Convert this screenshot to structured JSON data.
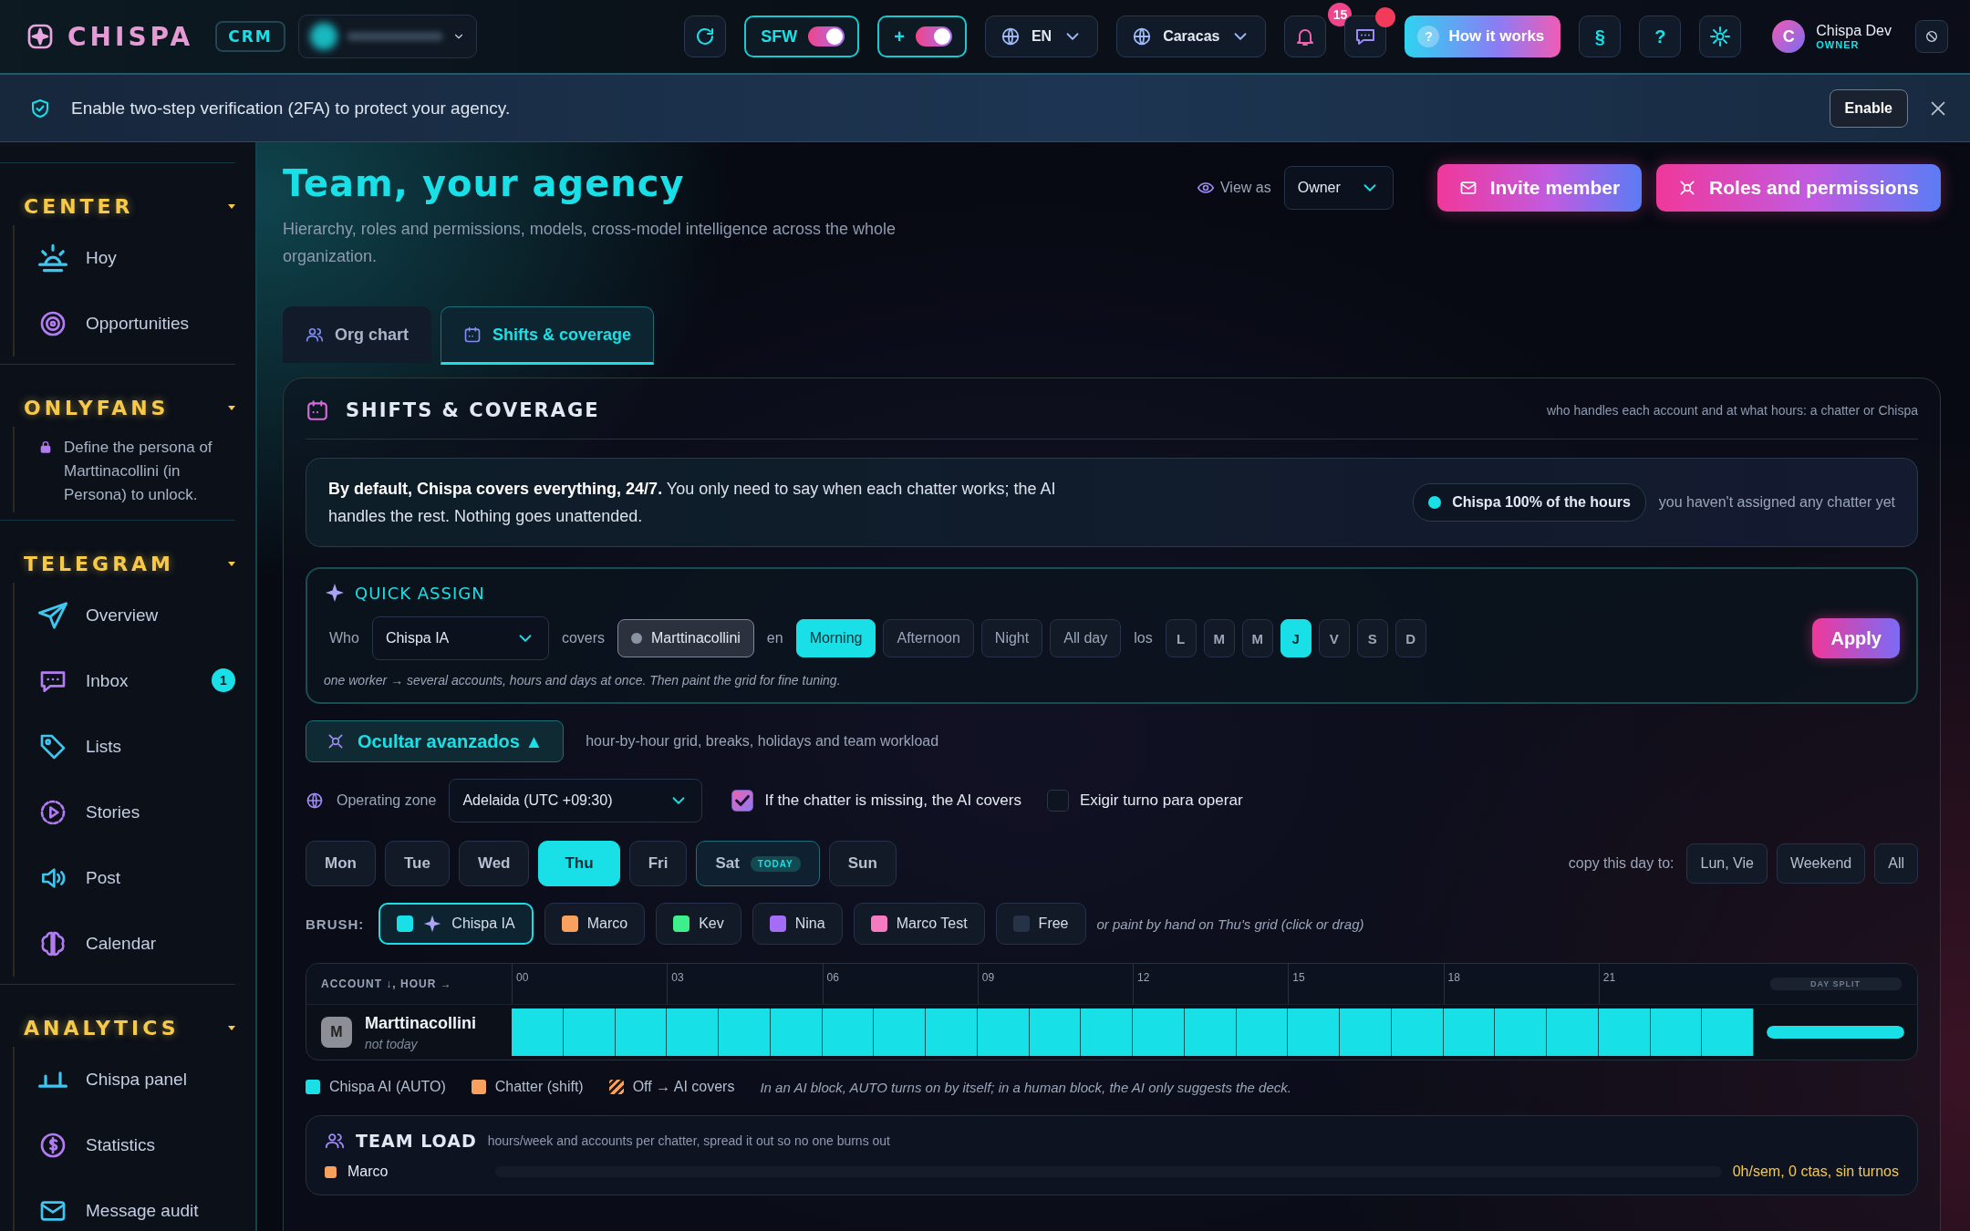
{
  "topbar": {
    "logo": "CHISPA",
    "badge": "CRM",
    "sfw": {
      "label": "SFW",
      "on": true
    },
    "plus_toggle": {
      "label": "+",
      "on": true
    },
    "language": "EN",
    "timezone": "Caracas",
    "notifications": {
      "count": "15"
    },
    "messages": {
      "unread": true
    },
    "help_button": {
      "icon": "?",
      "label": "How it works"
    },
    "section_button": "§",
    "question_button": "?",
    "user": {
      "initial": "C",
      "name": "Chispa Dev",
      "role": "OWNER"
    }
  },
  "banner": {
    "text": "Enable two-step verification (2FA) to protect your agency.",
    "button": "Enable"
  },
  "sidebar": {
    "sections": [
      {
        "title": "CENTER",
        "expanded": true,
        "items": [
          {
            "label": "Hoy"
          },
          {
            "label": "Opportunities"
          }
        ]
      },
      {
        "title": "ONLYFANS",
        "expanded": true,
        "note": "Define the persona of Marttinacollini (in Persona) to unlock."
      },
      {
        "title": "TELEGRAM",
        "expanded": true,
        "items": [
          {
            "label": "Overview"
          },
          {
            "label": "Inbox",
            "badge": "1"
          },
          {
            "label": "Lists"
          },
          {
            "label": "Stories"
          },
          {
            "label": "Post"
          },
          {
            "label": "Calendar"
          }
        ]
      },
      {
        "title": "ANALYTICS",
        "expanded": true,
        "items": [
          {
            "label": "Chispa panel"
          },
          {
            "label": "Statistics"
          },
          {
            "label": "Message audit"
          }
        ]
      }
    ]
  },
  "header": {
    "title": "Team, your agency",
    "subtitle": "Hierarchy, roles and permissions, models, cross-model intelligence across the whole organization.",
    "view_as_label": "View as",
    "view_as": "Owner",
    "buttons": [
      "Invite member",
      "Roles and permissions"
    ]
  },
  "tabs": [
    {
      "label": "Org chart",
      "selected": false
    },
    {
      "label": "Shifts & coverage",
      "selected": true
    }
  ],
  "panel": {
    "title": "SHIFTS & COVERAGE",
    "note": "who handles each account and at what hours: a chatter or Chispa",
    "info": {
      "text": "**By default, Chispa covers everything, 24/7.** You only need to say when each chatter works; the AI handles the rest. Nothing goes unattended.",
      "pill": "Chispa 100% of the hours",
      "note": "you haven't assigned any chatter yet"
    },
    "quick_assign": {
      "title": "QUICK ASSIGN",
      "who_label": "Who",
      "who": "Chispa IA",
      "covers_label": "covers",
      "account": {
        "label": "Marttinacollini",
        "selected": true
      },
      "en_label": "en",
      "shifts": [
        {
          "label": "Morning",
          "selected": true
        },
        {
          "label": "Afternoon",
          "selected": false
        },
        {
          "label": "Night",
          "selected": false
        },
        {
          "label": "All day",
          "selected": false
        }
      ],
      "days_label": "los",
      "days": [
        {
          "label": "L",
          "selected": false
        },
        {
          "label": "M",
          "selected": false
        },
        {
          "label": "M",
          "selected": false
        },
        {
          "label": "J",
          "selected": true
        },
        {
          "label": "V",
          "selected": false
        },
        {
          "label": "S",
          "selected": false
        },
        {
          "label": "D",
          "selected": false
        }
      ],
      "apply": "Apply",
      "hint": "one worker → several accounts, hours and days at once. Then paint the grid for fine tuning."
    },
    "advanced": {
      "button": "Ocultar avanzados ▲",
      "note": "hour-by-hour grid, breaks, holidays and team workload"
    },
    "zone": {
      "label": "Operating zone",
      "value": "Adelaida (UTC +09:30)"
    },
    "options": [
      {
        "label": "If the chatter is missing, the AI covers",
        "checked": true
      },
      {
        "label": "Exigir turno para operar",
        "checked": false
      }
    ],
    "weekdays": [
      {
        "label": "Mon",
        "selected": false
      },
      {
        "label": "Tue",
        "selected": false
      },
      {
        "label": "Wed",
        "selected": false
      },
      {
        "label": "Thu",
        "selected": true
      },
      {
        "label": "Fri",
        "selected": false
      },
      {
        "label": "Sat",
        "selected": false,
        "badge": "TODAY"
      },
      {
        "label": "Sun",
        "selected": false
      }
    ],
    "copy_label": "copy this day to:",
    "copy_buttons": [
      "Lun, Vie",
      "Weekend",
      "All"
    ],
    "brush_label": "BRUSH:",
    "brushes": [
      {
        "label": "Chispa IA",
        "color": "#19e0e6",
        "selected": true,
        "kind": "ai"
      },
      {
        "label": "Marco",
        "color": "#f8a15e",
        "selected": false,
        "kind": "person"
      },
      {
        "label": "Kev",
        "color": "#3ef08a",
        "selected": false,
        "kind": "person"
      },
      {
        "label": "Nina",
        "color": "#a56cf5",
        "selected": false,
        "kind": "person"
      },
      {
        "label": "Marco Test",
        "color": "#f57ac0",
        "selected": false,
        "kind": "person"
      },
      {
        "label": "Free",
        "color": "#263246",
        "selected": false,
        "kind": "person"
      }
    ],
    "brush_note": "or paint by hand on Thu's grid (click or drag)",
    "grid": {
      "corner": "ACCOUNT ↓, HOUR →",
      "hours": [
        "00",
        "03",
        "06",
        "09",
        "12",
        "15",
        "18",
        "21"
      ],
      "split_label": "DAY SPLIT",
      "rows": [
        {
          "initial": "M",
          "name": "Marttinacollini",
          "status": "not today",
          "cells": [
            {
              "color": "#17e0e6"
            },
            {
              "color": "#17e0e6"
            },
            {
              "color": "#17e0e6"
            },
            {
              "color": "#17e0e6"
            },
            {
              "color": "#17e0e6"
            },
            {
              "color": "#17e0e6"
            },
            {
              "color": "#17e0e6"
            },
            {
              "color": "#17e0e6"
            },
            {
              "color": "#17e0e6"
            },
            {
              "color": "#17e0e6"
            },
            {
              "color": "#17e0e6"
            },
            {
              "color": "#17e0e6"
            },
            {
              "color": "#17e0e6"
            },
            {
              "color": "#17e0e6"
            },
            {
              "color": "#17e0e6"
            },
            {
              "color": "#17e0e6"
            },
            {
              "color": "#17e0e6"
            },
            {
              "color": "#17e0e6"
            },
            {
              "color": "#17e0e6"
            },
            {
              "color": "#17e0e6"
            },
            {
              "color": "#17e0e6"
            },
            {
              "color": "#17e0e6"
            },
            {
              "color": "#17e0e6"
            },
            {
              "color": "#17e0e6"
            }
          ],
          "split": {
            "level": 1
          }
        }
      ]
    },
    "legend": [
      {
        "label": "Chispa AI (AUTO)",
        "kind": "solid",
        "color": "#19e0e6"
      },
      {
        "label": "Chatter (shift)",
        "kind": "solid",
        "color": "#f8a15e"
      },
      {
        "label": "Off → AI covers",
        "kind": "striped",
        "color": "#f8a15e"
      }
    ],
    "legend_note": "In an AI block, AUTO turns on by itself; in a human block, the AI only suggests the deck.",
    "team_load": {
      "title": "TEAM LOAD",
      "note": "hours/week and accounts per chatter, spread it out so no one burns out",
      "rows": [
        {
          "name": "Marco",
          "color": "#f8a15e",
          "level": 0,
          "summary": "0h/sem, 0 ctas, sin turnos"
        }
      ]
    }
  }
}
